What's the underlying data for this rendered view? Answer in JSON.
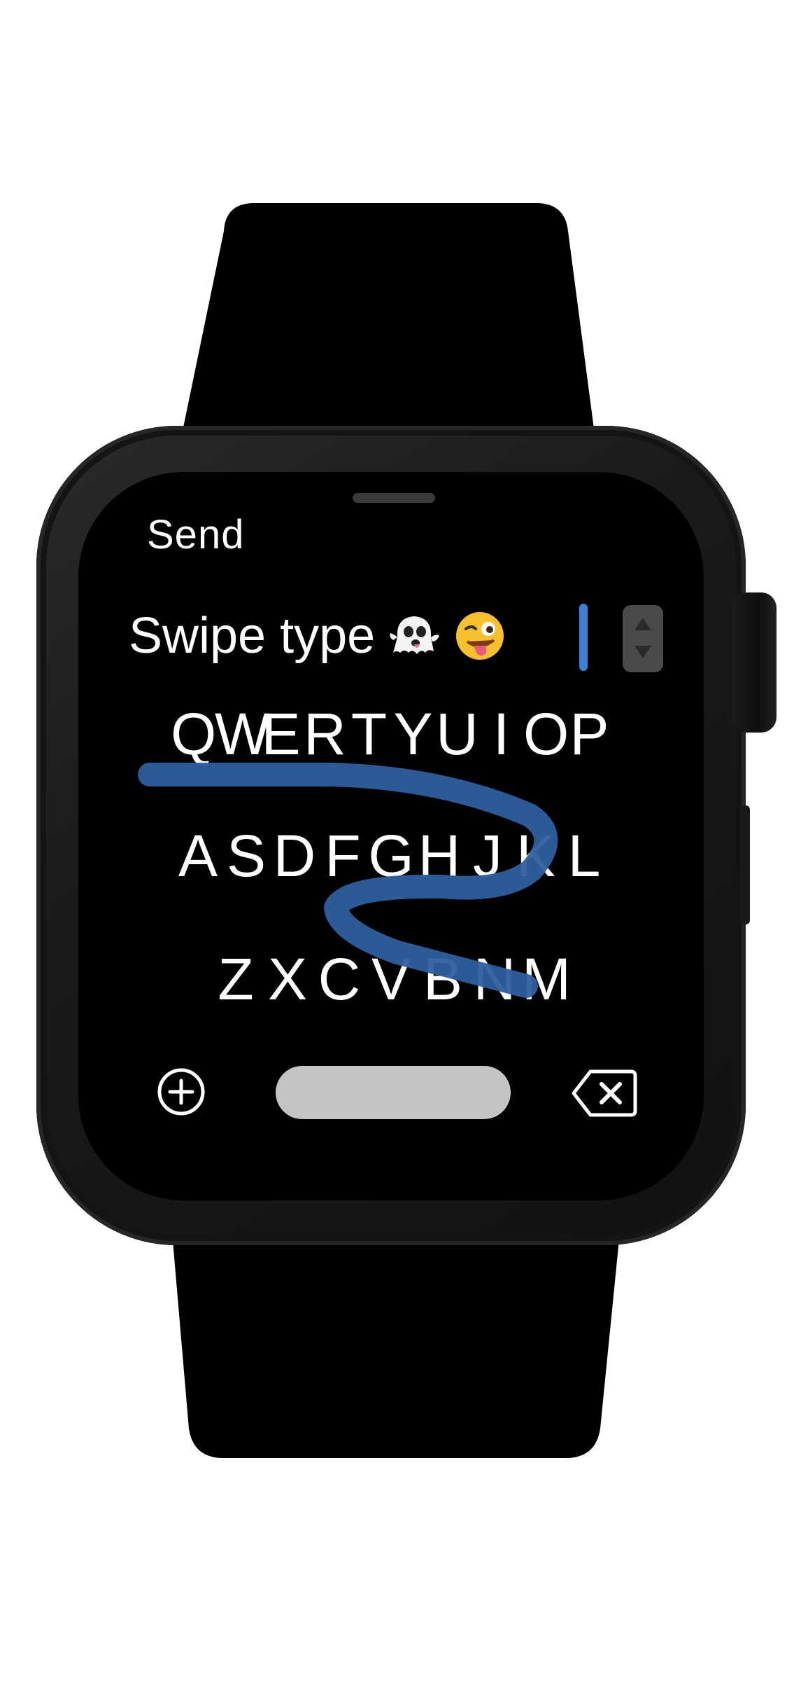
{
  "watch": {
    "send_label": "Send",
    "compose_text": "Swipe type",
    "emojis": [
      "ghost-emoji",
      "winking-face-with-tongue-emoji"
    ],
    "keyboard": {
      "row1": [
        "Q",
        "W",
        "E",
        "R",
        "T",
        "Y",
        "U",
        "I",
        "O",
        "P"
      ],
      "row2": [
        "A",
        "S",
        "D",
        "F",
        "G",
        "H",
        "J",
        "K",
        "L"
      ],
      "row3": [
        "Z",
        "X",
        "C",
        "V",
        "B",
        "N",
        "M"
      ]
    },
    "icons": {
      "add": "plus-circle-icon",
      "delete": "backspace-icon",
      "stepper": "up-down-stepper-icon"
    },
    "colors": {
      "accent": "#3b82d6",
      "swipe_trail": "#2e5f9e",
      "screen": "#000000",
      "space_bar": "#c4c4c4"
    }
  }
}
